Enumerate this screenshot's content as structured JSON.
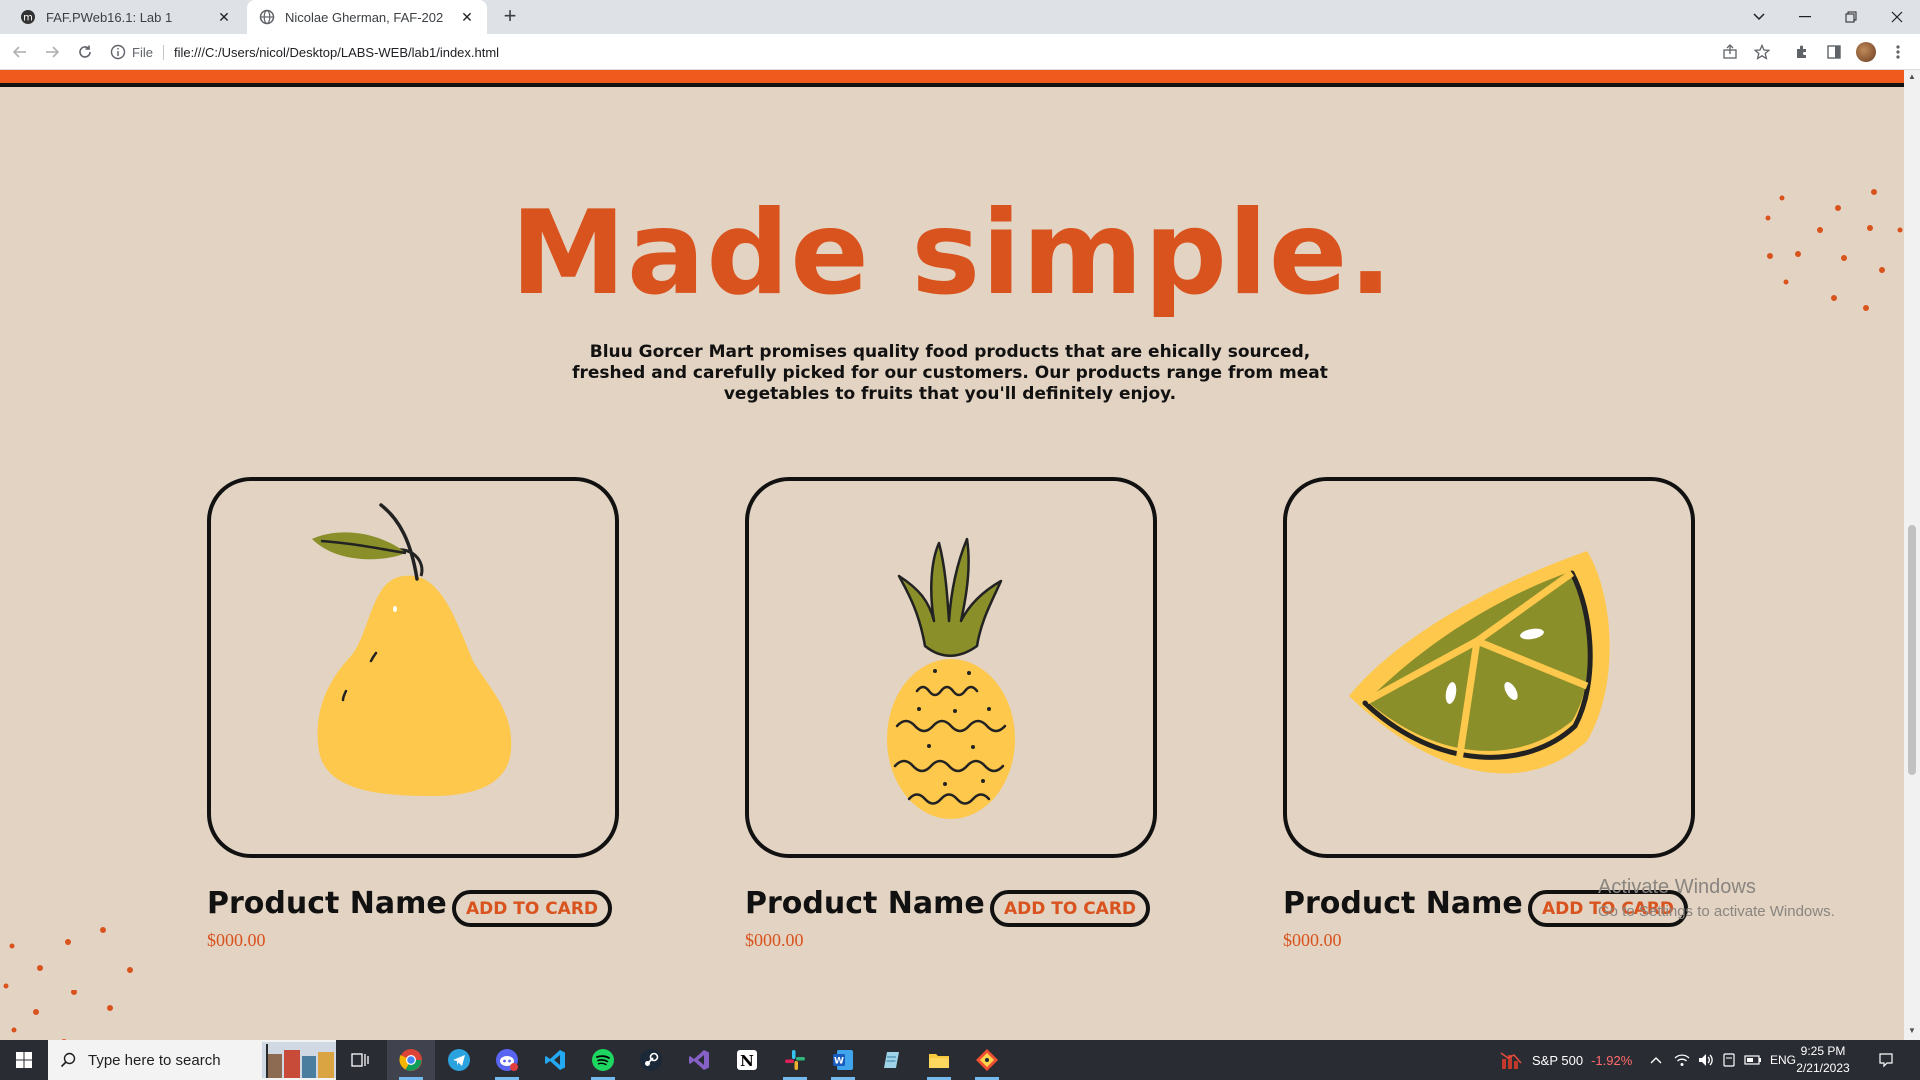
{
  "browser": {
    "tabs": [
      {
        "title": "FAF.PWeb16.1: Lab 1",
        "close": "✕"
      },
      {
        "title": "Nicolae Gherman, FAF-202",
        "close": "✕"
      }
    ],
    "new_tab": "+",
    "address": {
      "chip": "File",
      "url": "file:///C:/Users/nicol/Desktop/LABS-WEB/lab1/index.html"
    }
  },
  "page": {
    "title": "Made simple.",
    "description": "Bluu Gorcer Mart promises quality food products that are ehically sourced, freshed and carefully picked for our customers. Our products range from meat vegetables to fruits that you'll definitely enjoy.",
    "products": [
      {
        "image": "pear-illustration",
        "name": "Product Name",
        "price": "$000.00",
        "button": "ADD TO CARD"
      },
      {
        "image": "pineapple-illustration",
        "name": "Product Name",
        "price": "$000.00",
        "button": "ADD TO CARD"
      },
      {
        "image": "lime-slice-illustration",
        "name": "Product Name",
        "price": "$000.00",
        "button": "ADD TO CARD"
      }
    ],
    "colors": {
      "accent": "#d9531e",
      "background": "#e3d3c2",
      "header_bar": "#f05a1c"
    }
  },
  "watermark": {
    "line1": "Activate Windows",
    "line2": "Go to Settings to activate Windows."
  },
  "taskbar": {
    "search_placeholder": "Type here to search",
    "apps": [
      "chrome-icon",
      "telegram-icon",
      "discord-icon",
      "vscode-icon",
      "spotify-icon",
      "steam-icon",
      "visual-studio-icon",
      "notion-icon",
      "slack-icon",
      "word-icon",
      "notepad-icon",
      "file-explorer-icon",
      "git-icon"
    ],
    "stock": {
      "name": "S&P 500",
      "change": "-1.92%"
    },
    "language": "ENG",
    "time": "9:25 PM",
    "date": "2/21/2023"
  }
}
